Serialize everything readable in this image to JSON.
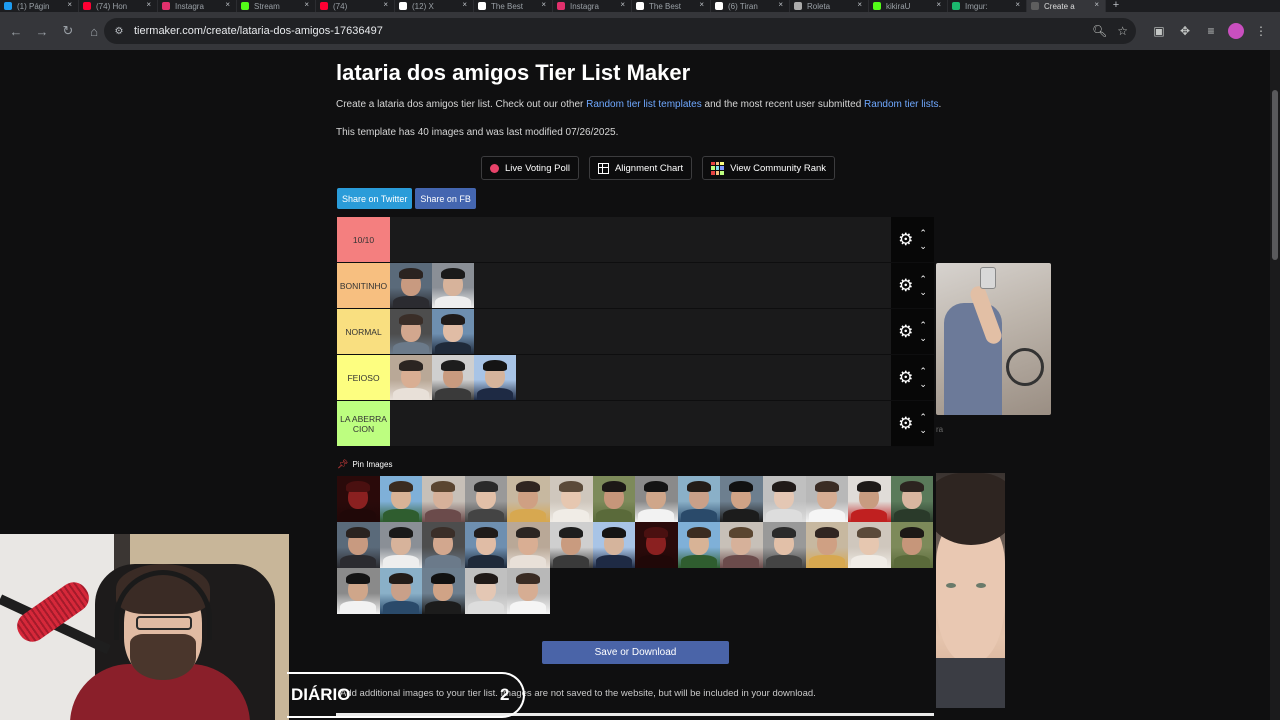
{
  "browser": {
    "tabs": [
      {
        "label": "(1) Págin",
        "color": "#1d9bf0"
      },
      {
        "label": "(74) Hon",
        "color": "#ff0033"
      },
      {
        "label": "Instagra",
        "color": "#e1306c"
      },
      {
        "label": "Stream",
        "color": "#53fc18"
      },
      {
        "label": "(74)",
        "color": "#ff0033"
      },
      {
        "label": "(12) X",
        "color": "#ffffff"
      },
      {
        "label": "The Best",
        "color": "#ffffff"
      },
      {
        "label": "Instagra",
        "color": "#e1306c"
      },
      {
        "label": "The Best",
        "color": "#ffffff"
      },
      {
        "label": "(6) Tiran",
        "color": "#ffffff"
      },
      {
        "label": "Roleta",
        "color": "#aaaaaa"
      },
      {
        "label": "kikiraU",
        "color": "#53fc18"
      },
      {
        "label": "Imgur:",
        "color": "#1bb76e"
      },
      {
        "label": "Create a",
        "color": "#5e5e5e"
      }
    ],
    "url": "tiermaker.com/create/lataria-dos-amigos-17636497"
  },
  "page": {
    "title": "lataria dos amigos Tier List Maker",
    "desc_prefix": "Create a lataria dos amigos tier list. Check out our other ",
    "desc_link1": "Random tier list templates",
    "desc_mid": " and the most recent user submitted ",
    "desc_link2": "Random tier lists",
    "desc_suffix": ".",
    "meta": "This template has 40 images and was last modified 07/26/2025.",
    "buttons": {
      "live_voting": "Live Voting Poll",
      "alignment": "Alignment Chart",
      "community": "View Community Rank"
    },
    "share": {
      "twitter": "Share on Twitter",
      "fb": "Share on FB"
    },
    "tiers": [
      {
        "label": "10/10",
        "color": "#f47f7f",
        "items": []
      },
      {
        "label": "BONITINHO",
        "color": "#f7bf80",
        "items": [
          0,
          1
        ]
      },
      {
        "label": "NORMAL",
        "color": "#f9df80",
        "items": [
          2,
          3
        ]
      },
      {
        "label": "FEIOSO",
        "color": "#fdfe80",
        "items": [
          4,
          5,
          6
        ]
      },
      {
        "label": "LA ABERRACION",
        "color": "#bdfe80",
        "items": []
      }
    ],
    "pin_images": "Pin Images",
    "save": "Save or Download",
    "add_note": "Add additional images to your tier list. Images are not saved to the website, but will be included in your download.",
    "right_text": "ra"
  },
  "stream": {
    "badge_title": "DIÁRIO",
    "badge_number": "2"
  }
}
